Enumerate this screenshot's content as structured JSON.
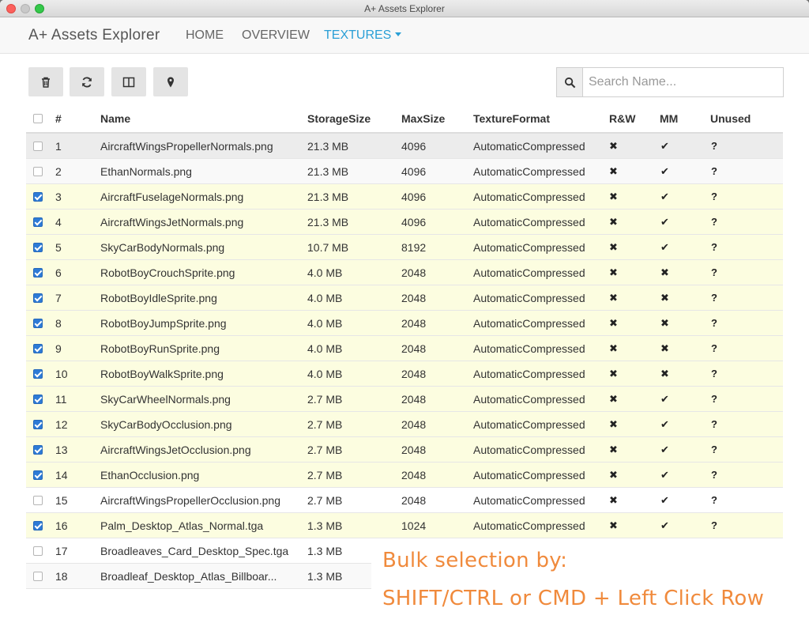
{
  "window": {
    "title": "A+ Assets Explorer"
  },
  "navbar": {
    "brand": "A+ Assets Explorer",
    "home": "HOME",
    "overview": "OVERVIEW",
    "textures": "TEXTURES"
  },
  "toolbar": {
    "buttons": [
      "trash-icon",
      "refresh-icon",
      "columns-icon",
      "map-marker-icon"
    ]
  },
  "search": {
    "placeholder": "Search Name..."
  },
  "table": {
    "headers": {
      "index": "#",
      "name": "Name",
      "storage": "StorageSize",
      "max": "MaxSize",
      "format": "TextureFormat",
      "rw": "R&W",
      "mm": "MM",
      "unused": "Unused"
    },
    "rows": [
      {
        "idx": "1",
        "name": "AircraftWingsPropellerNormals.png",
        "size": "21.3 MB",
        "max": "4096",
        "fmt": "AutomaticCompressed",
        "rw": "✖",
        "mm": "✔",
        "un": "?",
        "checked": false
      },
      {
        "idx": "2",
        "name": "EthanNormals.png",
        "size": "21.3 MB",
        "max": "4096",
        "fmt": "AutomaticCompressed",
        "rw": "✖",
        "mm": "✔",
        "un": "?",
        "checked": false
      },
      {
        "idx": "3",
        "name": "AircraftFuselageNormals.png",
        "size": "21.3 MB",
        "max": "4096",
        "fmt": "AutomaticCompressed",
        "rw": "✖",
        "mm": "✔",
        "un": "?",
        "checked": true
      },
      {
        "idx": "4",
        "name": "AircraftWingsJetNormals.png",
        "size": "21.3 MB",
        "max": "4096",
        "fmt": "AutomaticCompressed",
        "rw": "✖",
        "mm": "✔",
        "un": "?",
        "checked": true
      },
      {
        "idx": "5",
        "name": "SkyCarBodyNormals.png",
        "size": "10.7 MB",
        "max": "8192",
        "fmt": "AutomaticCompressed",
        "rw": "✖",
        "mm": "✔",
        "un": "?",
        "checked": true
      },
      {
        "idx": "6",
        "name": "RobotBoyCrouchSprite.png",
        "size": "4.0 MB",
        "max": "2048",
        "fmt": "AutomaticCompressed",
        "rw": "✖",
        "mm": "✖",
        "un": "?",
        "checked": true
      },
      {
        "idx": "7",
        "name": "RobotBoyIdleSprite.png",
        "size": "4.0 MB",
        "max": "2048",
        "fmt": "AutomaticCompressed",
        "rw": "✖",
        "mm": "✖",
        "un": "?",
        "checked": true
      },
      {
        "idx": "8",
        "name": "RobotBoyJumpSprite.png",
        "size": "4.0 MB",
        "max": "2048",
        "fmt": "AutomaticCompressed",
        "rw": "✖",
        "mm": "✖",
        "un": "?",
        "checked": true
      },
      {
        "idx": "9",
        "name": "RobotBoyRunSprite.png",
        "size": "4.0 MB",
        "max": "2048",
        "fmt": "AutomaticCompressed",
        "rw": "✖",
        "mm": "✖",
        "un": "?",
        "checked": true
      },
      {
        "idx": "10",
        "name": "RobotBoyWalkSprite.png",
        "size": "4.0 MB",
        "max": "2048",
        "fmt": "AutomaticCompressed",
        "rw": "✖",
        "mm": "✖",
        "un": "?",
        "checked": true
      },
      {
        "idx": "11",
        "name": "SkyCarWheelNormals.png",
        "size": "2.7 MB",
        "max": "2048",
        "fmt": "AutomaticCompressed",
        "rw": "✖",
        "mm": "✔",
        "un": "?",
        "checked": true
      },
      {
        "idx": "12",
        "name": "SkyCarBodyOcclusion.png",
        "size": "2.7 MB",
        "max": "2048",
        "fmt": "AutomaticCompressed",
        "rw": "✖",
        "mm": "✔",
        "un": "?",
        "checked": true
      },
      {
        "idx": "13",
        "name": "AircraftWingsJetOcclusion.png",
        "size": "2.7 MB",
        "max": "2048",
        "fmt": "AutomaticCompressed",
        "rw": "✖",
        "mm": "✔",
        "un": "?",
        "checked": true
      },
      {
        "idx": "14",
        "name": "EthanOcclusion.png",
        "size": "2.7 MB",
        "max": "2048",
        "fmt": "AutomaticCompressed",
        "rw": "✖",
        "mm": "✔",
        "un": "?",
        "checked": true
      },
      {
        "idx": "15",
        "name": "AircraftWingsPropellerOcclusion.png",
        "size": "2.7 MB",
        "max": "2048",
        "fmt": "AutomaticCompressed",
        "rw": "✖",
        "mm": "✔",
        "un": "?",
        "checked": false
      },
      {
        "idx": "16",
        "name": "Palm_Desktop_Atlas_Normal.tga",
        "size": "1.3 MB",
        "max": "1024",
        "fmt": "AutomaticCompressed",
        "rw": "✖",
        "mm": "✔",
        "un": "?",
        "checked": true
      },
      {
        "idx": "17",
        "name": "Broadleaves_Card_Desktop_Spec.tga",
        "size": "1.3 MB",
        "max": "",
        "fmt": "",
        "rw": "",
        "mm": "",
        "un": "",
        "checked": false
      },
      {
        "idx": "18",
        "name": "Broadleaf_Desktop_Atlas_Billboar...",
        "size": "1.3 MB",
        "max": "",
        "fmt": "",
        "rw": "",
        "mm": "",
        "un": "",
        "checked": false
      }
    ]
  },
  "annotation": {
    "line1": "Bulk selection by:",
    "line2": "SHIFT/CTRL or CMD + Left Click Row",
    "color": "#f08a3c"
  },
  "colors": {
    "accent": "#2a9fd6",
    "selected_row": "#fcfde0",
    "checkbox_on": "#2e7bd6"
  }
}
